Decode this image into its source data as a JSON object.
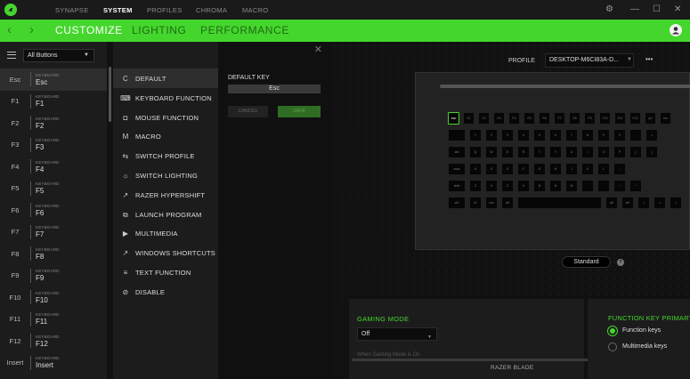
{
  "titlebar": {
    "tabs": [
      "SYNAPSE",
      "SYSTEM",
      "PROFILES",
      "CHROMA",
      "MACRO"
    ],
    "active_tab": "SYSTEM"
  },
  "subnav": {
    "tabs": [
      "CUSTOMIZE",
      "LIGHTING",
      "PERFORMANCE"
    ],
    "active_tab": "CUSTOMIZE"
  },
  "sidebar": {
    "filter": "All Buttons",
    "keys": [
      {
        "name": "Esc",
        "category": "KEYBOARD",
        "value": "Esc"
      },
      {
        "name": "F1",
        "category": "KEYBOARD",
        "value": "F1"
      },
      {
        "name": "F2",
        "category": "KEYBOARD",
        "value": "F2"
      },
      {
        "name": "F3",
        "category": "KEYBOARD",
        "value": "F3"
      },
      {
        "name": "F4",
        "category": "KEYBOARD",
        "value": "F4"
      },
      {
        "name": "F5",
        "category": "KEYBOARD",
        "value": "F5"
      },
      {
        "name": "F6",
        "category": "KEYBOARD",
        "value": "F6"
      },
      {
        "name": "F7",
        "category": "KEYBOARD",
        "value": "F7"
      },
      {
        "name": "F8",
        "category": "KEYBOARD",
        "value": "F8"
      },
      {
        "name": "F9",
        "category": "KEYBOARD",
        "value": "F9"
      },
      {
        "name": "F10",
        "category": "KEYBOARD",
        "value": "F10"
      },
      {
        "name": "F11",
        "category": "KEYBOARD",
        "value": "F11"
      },
      {
        "name": "F12",
        "category": "KEYBOARD",
        "value": "F12"
      },
      {
        "name": "Insert",
        "category": "KEYBOARD",
        "value": "Insert"
      }
    ]
  },
  "functions": {
    "items": [
      {
        "label": "DEFAULT",
        "icon": "reset-icon"
      },
      {
        "label": "KEYBOARD FUNCTION",
        "icon": "keyboard-icon"
      },
      {
        "label": "MOUSE FUNCTION",
        "icon": "mouse-icon"
      },
      {
        "label": "MACRO",
        "icon": "macro-icon"
      },
      {
        "label": "SWITCH PROFILE",
        "icon": "switch-icon"
      },
      {
        "label": "SWITCH LIGHTING",
        "icon": "lighting-icon"
      },
      {
        "label": "RAZER HYPERSHIFT",
        "icon": "hypershift-icon"
      },
      {
        "label": "LAUNCH PROGRAM",
        "icon": "launch-icon"
      },
      {
        "label": "MULTIMEDIA",
        "icon": "multimedia-icon"
      },
      {
        "label": "WINDOWS SHORTCUTS",
        "icon": "shortcut-icon"
      },
      {
        "label": "TEXT FUNCTION",
        "icon": "text-icon"
      },
      {
        "label": "DISABLE",
        "icon": "disable-icon"
      }
    ]
  },
  "detail": {
    "label": "DEFAULT KEY",
    "value": "Esc",
    "cancel": "CANCEL",
    "save": "SAVE"
  },
  "profile": {
    "label": "PROFILE",
    "value": "DESKTOP-M6CI83A-D...",
    "more": "•••"
  },
  "keyboard": {
    "row0": [
      "esc",
      "F1",
      "F2",
      "F3",
      "F4",
      "F5",
      "F6",
      "F7",
      "F8",
      "F9",
      "F10",
      "F11",
      "F12",
      "prt",
      "ins"
    ],
    "row1": [
      "`",
      "1",
      "2",
      "3",
      "4",
      "5",
      "6",
      "7",
      "8",
      "9",
      "0",
      "-",
      "="
    ],
    "row2": [
      "tab",
      "Q",
      "W",
      "E",
      "R",
      "T",
      "Y",
      "U",
      "I",
      "O",
      "P",
      "[",
      "]"
    ],
    "row3": [
      "caps",
      "A",
      "S",
      "D",
      "F",
      "G",
      "H",
      "J",
      "K",
      "L",
      ";"
    ],
    "row4": [
      "shift",
      "Z",
      "X",
      "C",
      "V",
      "B",
      "N",
      "M",
      ",",
      ".",
      "/",
      "^"
    ],
    "row5": [
      "ctrl",
      "fn",
      "win",
      "alt",
      "",
      "alt",
      "ctrl",
      "<",
      "v",
      ">"
    ]
  },
  "view": {
    "standard": "Standard",
    "info": "?"
  },
  "gaming": {
    "title": "GAMING MODE",
    "value": "Off",
    "note": "When Gaming Mode is On"
  },
  "fkeys": {
    "title": "FUNCTION KEY PRIMARY",
    "options": [
      "Function keys",
      "Multimedia keys"
    ]
  },
  "device": "RAZER BLADE",
  "colors": {
    "accent": "#44d62c"
  }
}
